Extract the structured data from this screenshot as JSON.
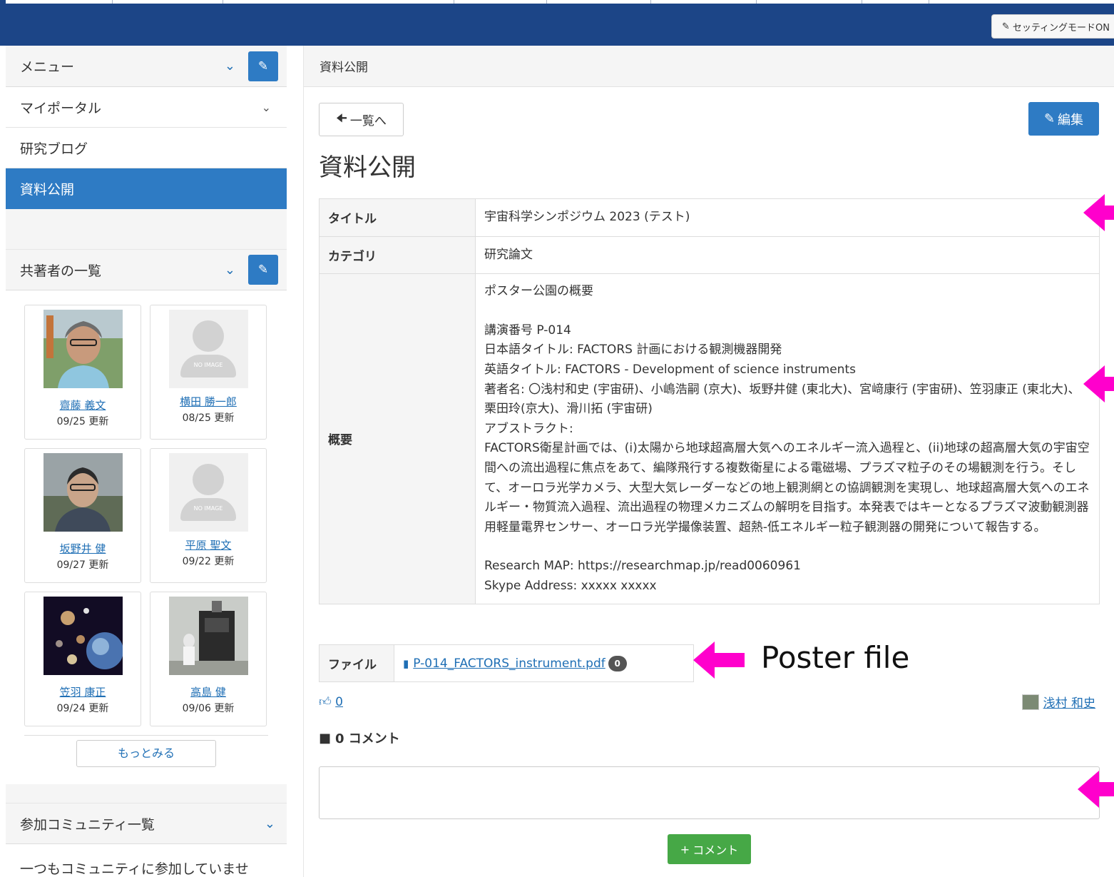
{
  "header": {
    "setting_mode_label": "セッティングモードON"
  },
  "sidebar": {
    "menu_title": "メニュー",
    "menu_items": [
      {
        "label": "マイポータル",
        "expandable": true,
        "active": false
      },
      {
        "label": "研究ブログ",
        "expandable": false,
        "active": false
      },
      {
        "label": "資料公開",
        "expandable": false,
        "active": true
      }
    ],
    "coauthors_title": "共著者の一覧",
    "coauthors": [
      {
        "name": "齋藤 義文",
        "updated": "09/25 更新",
        "image": "photo"
      },
      {
        "name": "横田 勝一郎",
        "updated": "08/25 更新",
        "image": "no-image"
      },
      {
        "name": "坂野井 健",
        "updated": "09/27 更新",
        "image": "photo"
      },
      {
        "name": "平原 聖文",
        "updated": "09/22 更新",
        "image": "no-image"
      },
      {
        "name": "笠羽 康正",
        "updated": "09/24 更新",
        "image": "photo"
      },
      {
        "name": "高島 健",
        "updated": "09/06 更新",
        "image": "photo"
      }
    ],
    "no_image_text": "NO IMAGE",
    "more_label": "もっとみる",
    "community_title": "参加コミュニティ一覧",
    "community_empty": "一つもコミュニティに参加していません。"
  },
  "main": {
    "breadcrumb": "資料公開",
    "back_label": "一覧へ",
    "edit_label": "編集",
    "page_title": "資料公開",
    "fields": {
      "title_key": "タイトル",
      "title_value": "宇宙科学シンポジウム 2023 (テスト)",
      "category_key": "カテゴリ",
      "category_value": "研究論文",
      "summary_key": "概要",
      "summary_heading": "ポスター公園の概要",
      "summary_lines": [
        "講演番号 P-014",
        "日本語タイトル: FACTORS 計画における観測機器開発",
        "英語タイトル: FACTORS - Development of science instruments"
      ],
      "authors_line": "著者名: 〇浅村和史 (宇宙研)、小嶋浩嗣 (京大)、坂野井健 (東北大)、宮﨑康行 (宇宙研)、笠羽康正 (東北大)、栗田玲(京大)、滑川拓 (宇宙研)",
      "abstract_label": "アブストラクト:",
      "abstract_text": "FACTORS衛星計画では、(i)太陽から地球超高層大気へのエネルギー流入過程と、(ii)地球の超高層大気の宇宙空間への流出過程に焦点をあて、編隊飛行する複数衛星による電磁場、プラズマ粒子のその場観測を行う。そして、オーロラ光学カメラ、大型大気レーダーなどの地上観測網との協調観測を実現し、地球超高層大気へのエネルギー・物質流入過程、流出過程の物理メカニズムの解明を目指す。本発表ではキーとなるプラズマ波動観測器用軽量電界センサー、オーロラ光学撮像装置、超熱-低エネルギー粒子観測器の開発について報告する。",
      "research_map": "Research MAP: https://researchmap.jp/read0060961",
      "skype": "Skype Address: xxxxx xxxxx"
    },
    "file_key": "ファイル",
    "file_name": "P-014_FACTORS_instrument.pdf",
    "file_downloads": "0",
    "likes": "0",
    "author_name": "浅村 和史",
    "comment_count_label": "0 コメント",
    "comment_button": "コメント"
  },
  "annotations": {
    "poster_label": "Poster file",
    "arrow_color": "#ff00cc"
  }
}
